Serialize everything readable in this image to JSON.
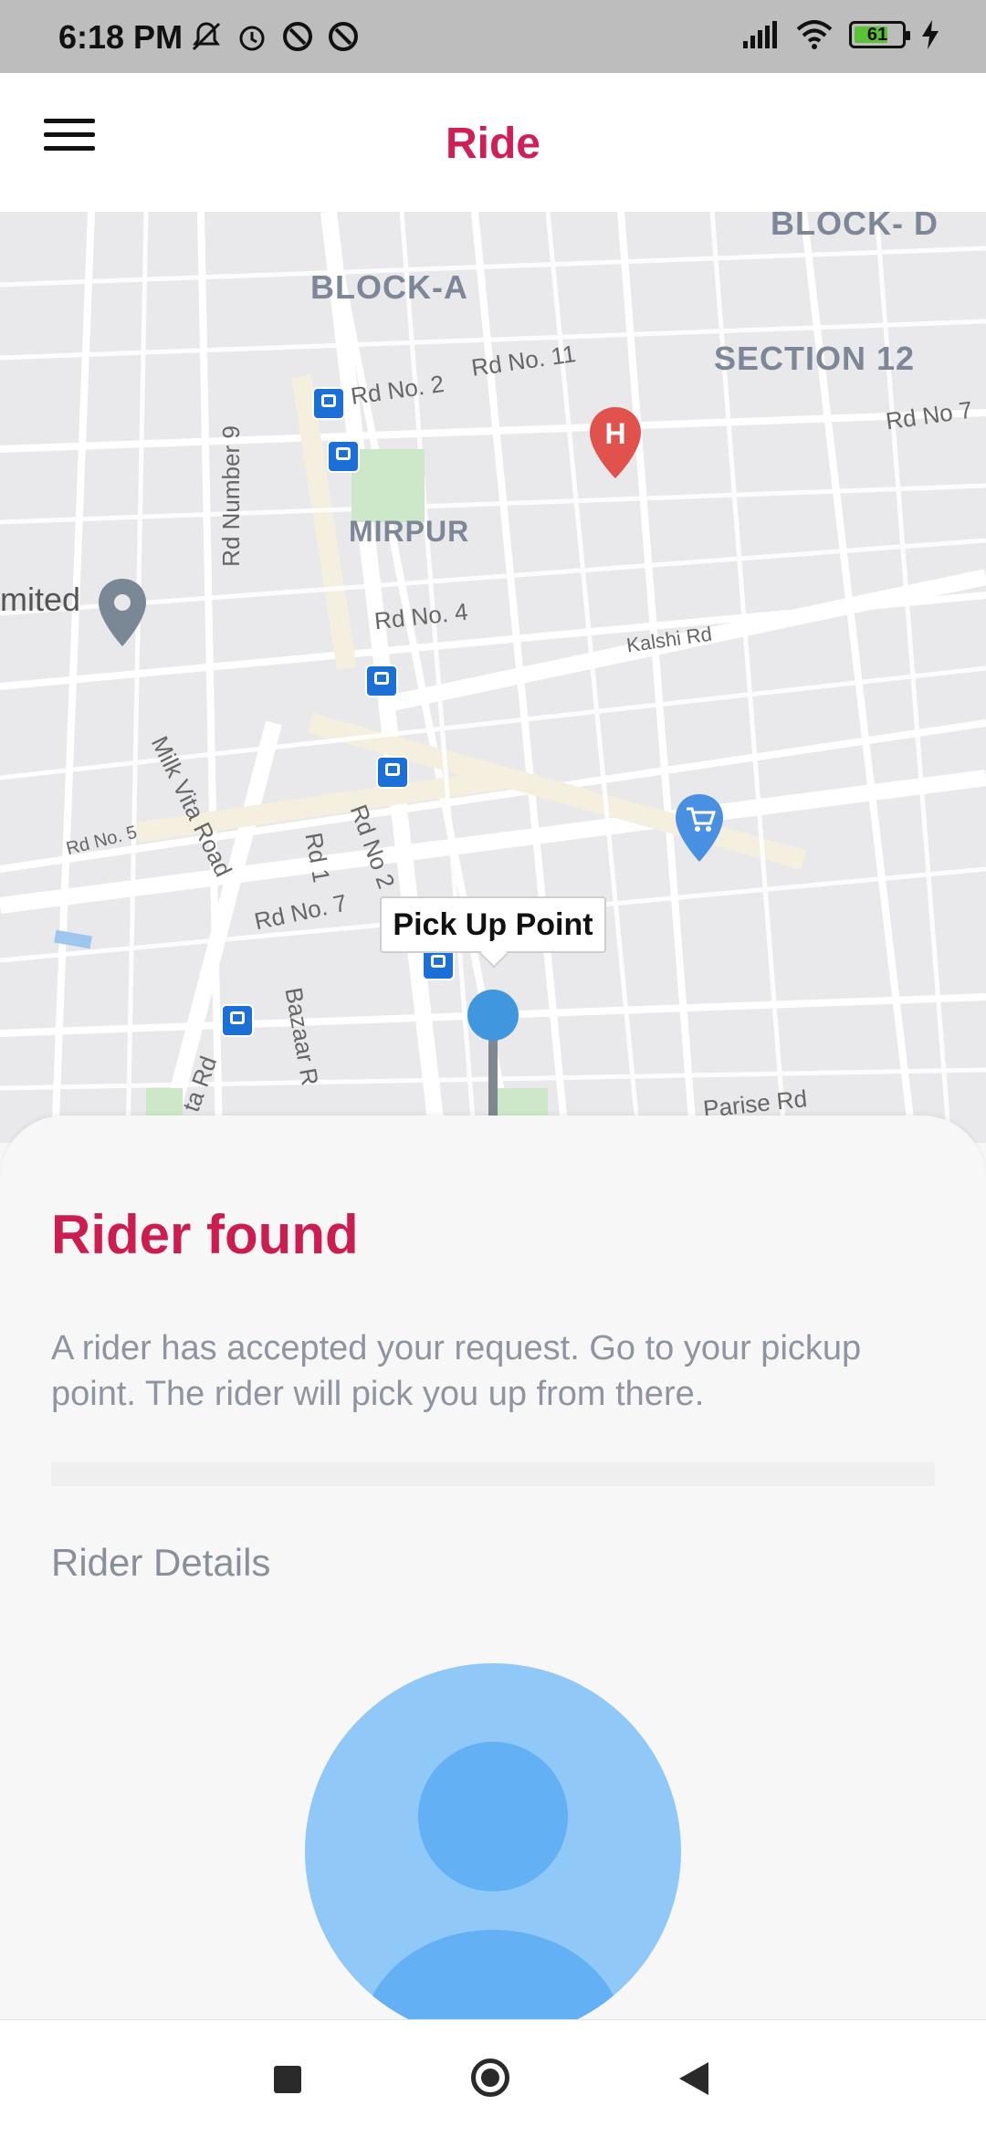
{
  "status_bar": {
    "time": "6:18 PM",
    "battery_level": "61",
    "icons": [
      "mute-icon",
      "alarm-icon",
      "data-saver-icon",
      "data-saver-icon",
      "signal-icon",
      "wifi-icon",
      "battery-icon",
      "charging-icon"
    ]
  },
  "app_bar": {
    "title": "Ride",
    "menu_icon": "hamburger-menu-icon",
    "accent_color": "#d01f54"
  },
  "map": {
    "area_labels": [
      "BLOCK- D",
      "BLOCK-A",
      "SECTION 12",
      "MIRPUR"
    ],
    "road_labels": [
      "Rd No. 2",
      "Rd No. 11",
      "Rd No 7",
      "Rd Number 9",
      "Rd No. 4",
      "Kalshi Rd",
      "Milk Vita Road",
      "Rd No. 5",
      "Rd 1",
      "Rd No 2",
      "Rd No. 7",
      "Bazaar R",
      "ta Rd",
      "Parise Rd"
    ],
    "place_label": "mited",
    "pickup_callout": "Pick Up Point",
    "poi_icons": [
      "hospital-icon",
      "shopping-cart-icon",
      "place-marker-icon",
      "bus-stop-icon"
    ]
  },
  "sheet": {
    "title": "Rider found",
    "description": "A rider has accepted your request. Go to your pickup point. The rider will pick you up from there.",
    "details_heading": "Rider Details"
  },
  "nav_bar": {
    "icons": [
      "recents-icon",
      "home-icon",
      "back-icon"
    ]
  }
}
